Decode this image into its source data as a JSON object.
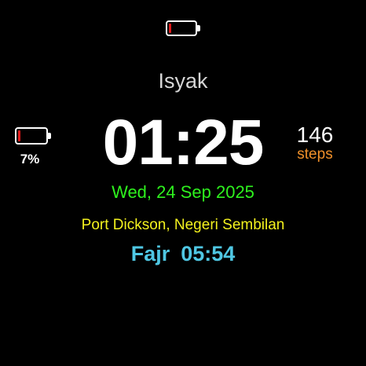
{
  "watchface": {
    "top_battery": {
      "icon": "battery-low-icon",
      "level_percent": 7,
      "fill_color": "#e01818"
    },
    "current_prayer": "Isyak",
    "battery": {
      "icon": "battery-low-icon",
      "percent_label": "7%",
      "level_percent": 7,
      "fill_color": "#e01818"
    },
    "time": "01:25",
    "steps": {
      "count": "146",
      "label": "steps",
      "label_color": "#f0902a"
    },
    "date": "Wed, 24 Sep 2025",
    "date_color": "#2ef21e",
    "location": "Port Dickson, Negeri Sembilan",
    "location_color": "#f4f21e",
    "next_prayer": {
      "name": "Fajr",
      "time": "05:54",
      "color": "#4fc7e3"
    }
  }
}
